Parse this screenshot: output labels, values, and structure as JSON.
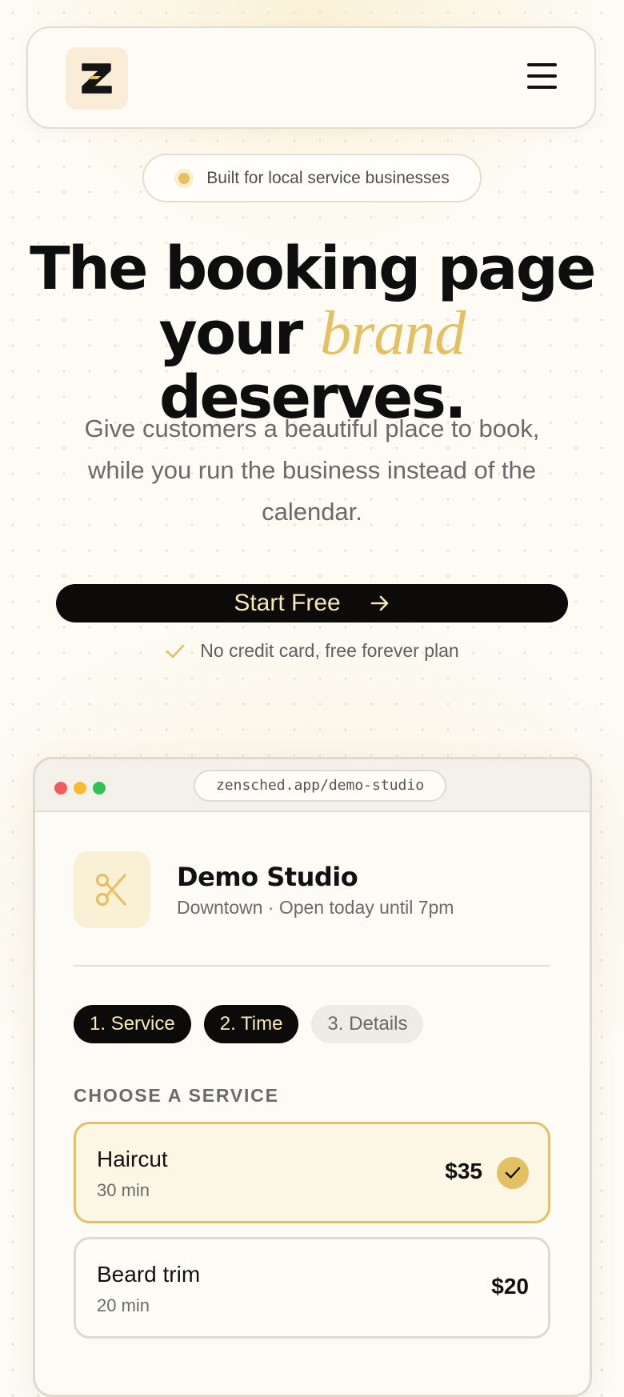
{
  "header": {
    "logo_icon": "zensched-logo-icon",
    "menu_icon": "hamburger-menu-icon"
  },
  "badge": {
    "text": "Built for local service businesses"
  },
  "hero": {
    "headline_line1": "The booking page",
    "headline_pre": "your",
    "headline_accent": "brand",
    "headline_post": "deserves.",
    "subheadline": "Give customers a beautiful place to book, while you run the business instead of the calendar."
  },
  "cta": {
    "label": "Start Free",
    "icon": "arrow-right-icon",
    "note": "No credit card, free forever plan",
    "note_icon": "check-icon"
  },
  "preview": {
    "url": "zensched.app/demo-studio",
    "business": {
      "icon": "scissors-icon",
      "name": "Demo Studio",
      "meta": "Downtown · Open today until 7pm"
    },
    "steps": [
      {
        "label": "1. Service",
        "active": true
      },
      {
        "label": "2. Time",
        "active": true
      },
      {
        "label": "3. Details",
        "active": false
      }
    ],
    "section_label": "CHOOSE A SERVICE",
    "services": [
      {
        "name": "Haircut",
        "duration": "30 min",
        "price": "$35",
        "selected": true
      },
      {
        "name": "Beard trim",
        "duration": "20 min",
        "price": "$20",
        "selected": false
      }
    ]
  },
  "colors": {
    "accent": "#e3c062",
    "dark": "#0c0b0a",
    "cta_text": "#f7e8b8",
    "background": "#fdfbf4"
  }
}
